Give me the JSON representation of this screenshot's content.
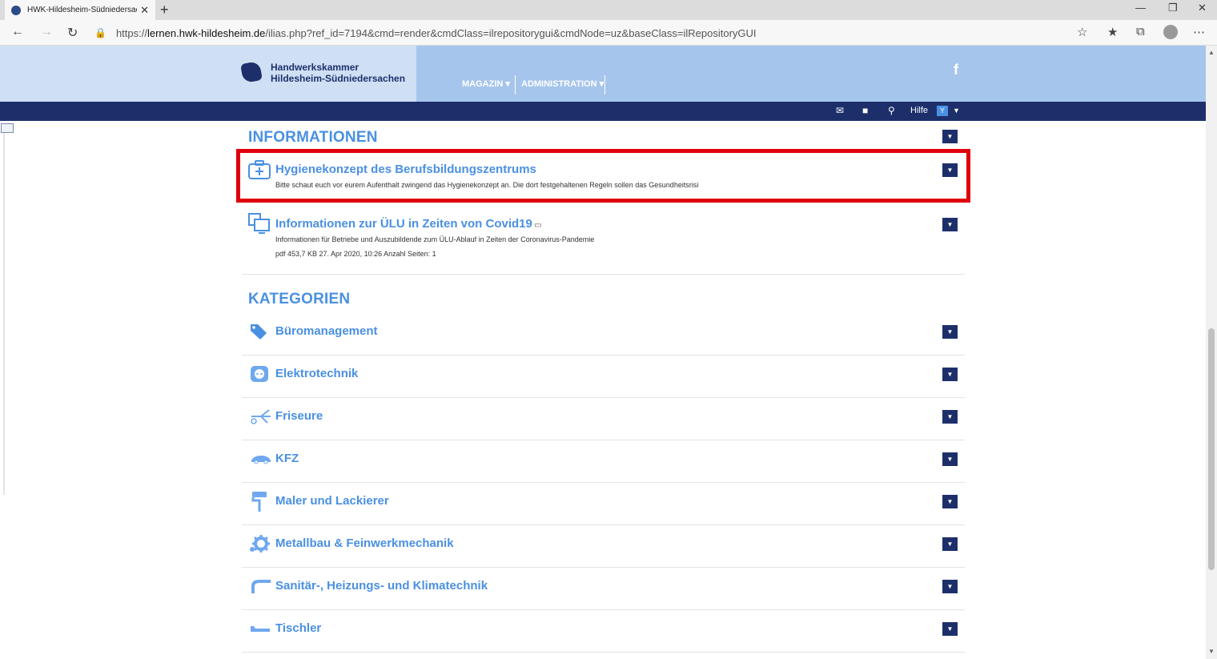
{
  "browser": {
    "tab_title": "HWK-Hildesheim-Südniedersach",
    "tab_close": "✕",
    "new_tab": "+",
    "url_prefix": "https://",
    "url_host": "lernen.hwk-hildesheim.de",
    "url_path": "/ilias.php?ref_id=7194&cmd=render&cmdClass=ilrepositorygui&cmdNode=uz&baseClass=ilRepositoryGUI"
  },
  "header": {
    "logo_line1": "Handwerkskammer",
    "logo_line2": "Hildesheim-Südniedersachen",
    "menu": [
      {
        "label": "MAGAZIN ▾"
      },
      {
        "label": "ADMINISTRATION ▾"
      }
    ],
    "facebook": "f",
    "help_label": "Hilfe",
    "user_initial": "Y"
  },
  "informationen": {
    "title": "INFORMATIONEN",
    "items": [
      {
        "title": "Hygienekonzept des Berufsbildungszentrums",
        "desc": "Bitte schaut euch vor eurem Aufenthalt zwingend das Hygienekonzept an. Die dort festgehaltenen Regeln sollen das Gesundheitsrisi"
      },
      {
        "title": "Informationen zur ÜLU in Zeiten von Covid19",
        "desc": "Informationen für Betriebe und Auszubildende zum ÜLU-Ablauf in Zeiten der Coronavirus-Pandemie",
        "props": "pdf   453,7 KB   27. Apr 2020, 10:26   Anzahl Seiten: 1"
      }
    ]
  },
  "kategorien": {
    "title": "KATEGORIEN",
    "items": [
      {
        "label": "Büromanagement"
      },
      {
        "label": "Elektrotechnik"
      },
      {
        "label": "Friseure"
      },
      {
        "label": "KFZ"
      },
      {
        "label": "Maler und Lackierer"
      },
      {
        "label": "Metallbau & Feinwerkmechanik"
      },
      {
        "label": "Sanitär-, Heizungs- und Klimatechnik"
      },
      {
        "label": "Tischler"
      }
    ]
  },
  "colors": {
    "accent": "#4a90e2",
    "navy": "#1d2f6b",
    "highlight": "#e0000b"
  }
}
